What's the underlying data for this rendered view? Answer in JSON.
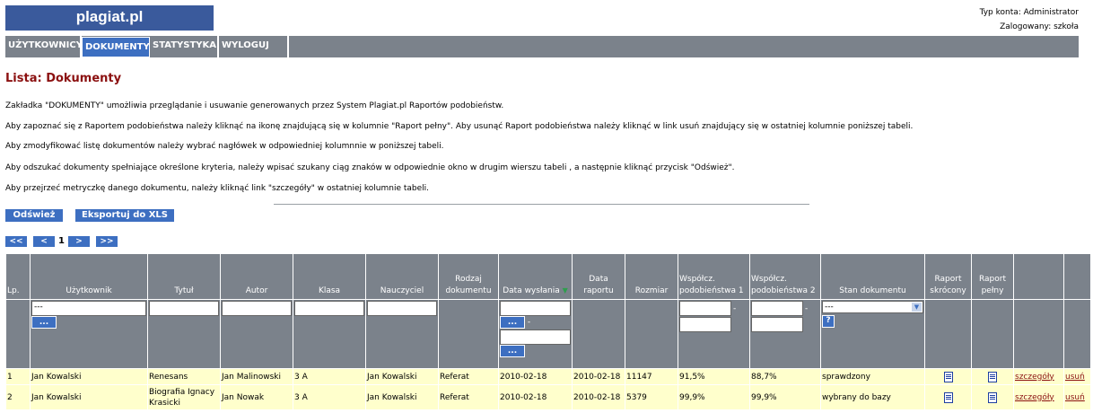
{
  "header": {
    "logo": "plagiat.pl",
    "account_type": "Typ konta: Administrator",
    "logged_in": "Zalogowany:  szkoła"
  },
  "nav": {
    "items": [
      {
        "label": "UŻYTKOWNICY",
        "active": false
      },
      {
        "label": "DOKUMENTY",
        "active": true
      },
      {
        "label": "STATYSTYKA",
        "active": false
      },
      {
        "label": "WYLOGUJ SIĘ",
        "active": false
      }
    ]
  },
  "page": {
    "title": "Lista: Dokumenty",
    "paragraphs": [
      "Zakładka \"DOKUMENTY\" umożliwia przeglądanie i usuwanie generowanych przez System Plagiat.pl Raportów podobieństw.",
      "Aby zapoznać się z Raportem podobieństwa należy kliknąć na ikonę znajdującą się w kolumnie \"Raport pełny\". Aby usunąć Raport podobieństwa należy kliknąć w link usuń znajdujący się w ostatniej kolumnie poniższej tabeli.",
      "Aby zmodyfikować listę dokumentów należy wybrać nagłówek w odpowiedniej kolumnnie w poniższej tabeli.",
      "Aby odszukać dokumenty spełniające określone kryteria, należy wpisać szukany ciąg znaków w odpowiednie okno w drugim wierszu tabeli , a następnie kliknąć przycisk \"Odśwież\".",
      "Aby przejrzeć metryczkę danego dokumentu, należy kliknąć link \"szczegóły\" w ostatniej kolumnie tabeli."
    ]
  },
  "actions": {
    "refresh": "Odśwież",
    "export": "Eksportuj do XLS"
  },
  "pager": {
    "first": "<<",
    "prev": "<",
    "current": "1",
    "next": ">",
    "last": ">>"
  },
  "table": {
    "headers": {
      "lp": "Lp.",
      "user": "Użytkownik",
      "title": "Tytuł",
      "author": "Autor",
      "class": "Klasa",
      "teacher": "Nauczyciel",
      "doc_type": "Rodzaj dokumentu",
      "sent_date": "Data wysłania",
      "report_date": "Data raportu",
      "size": "Rozmiar",
      "coef1": "Współcz. podobieństwa 1",
      "coef2": "Współcz. podobieństwa 2",
      "state": "Stan dokumentu",
      "short_report": "Raport skrócony",
      "full_report": "Raport pełny"
    },
    "filters": {
      "user_value": "---",
      "state_value": "---",
      "dots": "...",
      "dash": "-",
      "help": "?"
    },
    "rows": [
      {
        "lp": "1",
        "user": "Jan Kowalski",
        "title": "Renesans",
        "author": "Jan Malinowski",
        "class": "3 A",
        "teacher": "Jan Kowalski",
        "doc_type": "Referat",
        "sent_date": "2010-02-18",
        "report_date": "2010-02-18",
        "size": "11147",
        "coef1": "91,5%",
        "coef2": "88,7%",
        "state": "sprawdzony",
        "details": "szczegóły",
        "delete": "usuń"
      },
      {
        "lp": "2",
        "user": "Jan Kowalski",
        "title": "Biografia Ignacy Krasicki",
        "author": "Jan Nowak",
        "class": "3 A",
        "teacher": "Jan Kowalski",
        "doc_type": "Referat",
        "sent_date": "2010-02-18",
        "report_date": "2010-02-18",
        "size": "5379",
        "coef1": "99,9%",
        "coef2": "99,9%",
        "state": "wybrany do bazy",
        "details": "szczegóły",
        "delete": "usuń"
      }
    ]
  },
  "colors": {
    "brand_blue": "#3d6fc1",
    "nav_gray": "#7b828b",
    "title_red": "#8b1010",
    "row_yellow": "#ffffcc"
  }
}
